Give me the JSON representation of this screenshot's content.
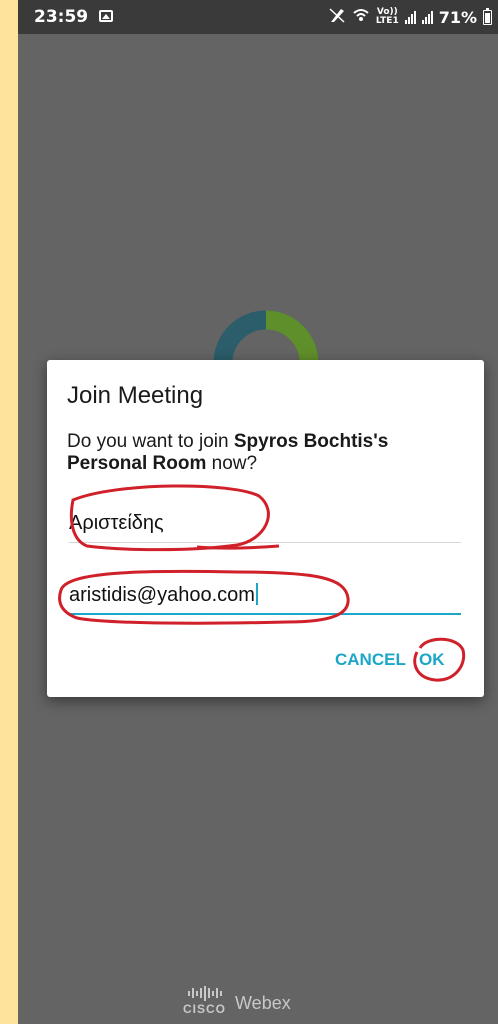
{
  "status_bar": {
    "time": "23:59",
    "network_label_top": "Vo))",
    "network_label_bottom": "LTE1",
    "battery": "71%"
  },
  "dialog": {
    "title": "Join Meeting",
    "message_prefix": "Do you want to join ",
    "message_bold": "Spyros Bochtis's Personal Room",
    "message_suffix": " now?",
    "name_value": "Αριστείδης",
    "email_value": "aristidis@yahoo.com",
    "cancel_label": "CANCEL",
    "ok_label": "OK"
  },
  "footer": {
    "cisco_label": "CISCO",
    "product_label": "Webex"
  },
  "colors": {
    "accent": "#1ba7c7",
    "annotation": "#d0202a",
    "overlay": "#646464"
  },
  "icons": [
    "gallery-icon",
    "no-sim-icon",
    "wifi-calling-icon",
    "signal-icon",
    "battery-icon",
    "loading-spinner",
    "cisco-logo"
  ]
}
